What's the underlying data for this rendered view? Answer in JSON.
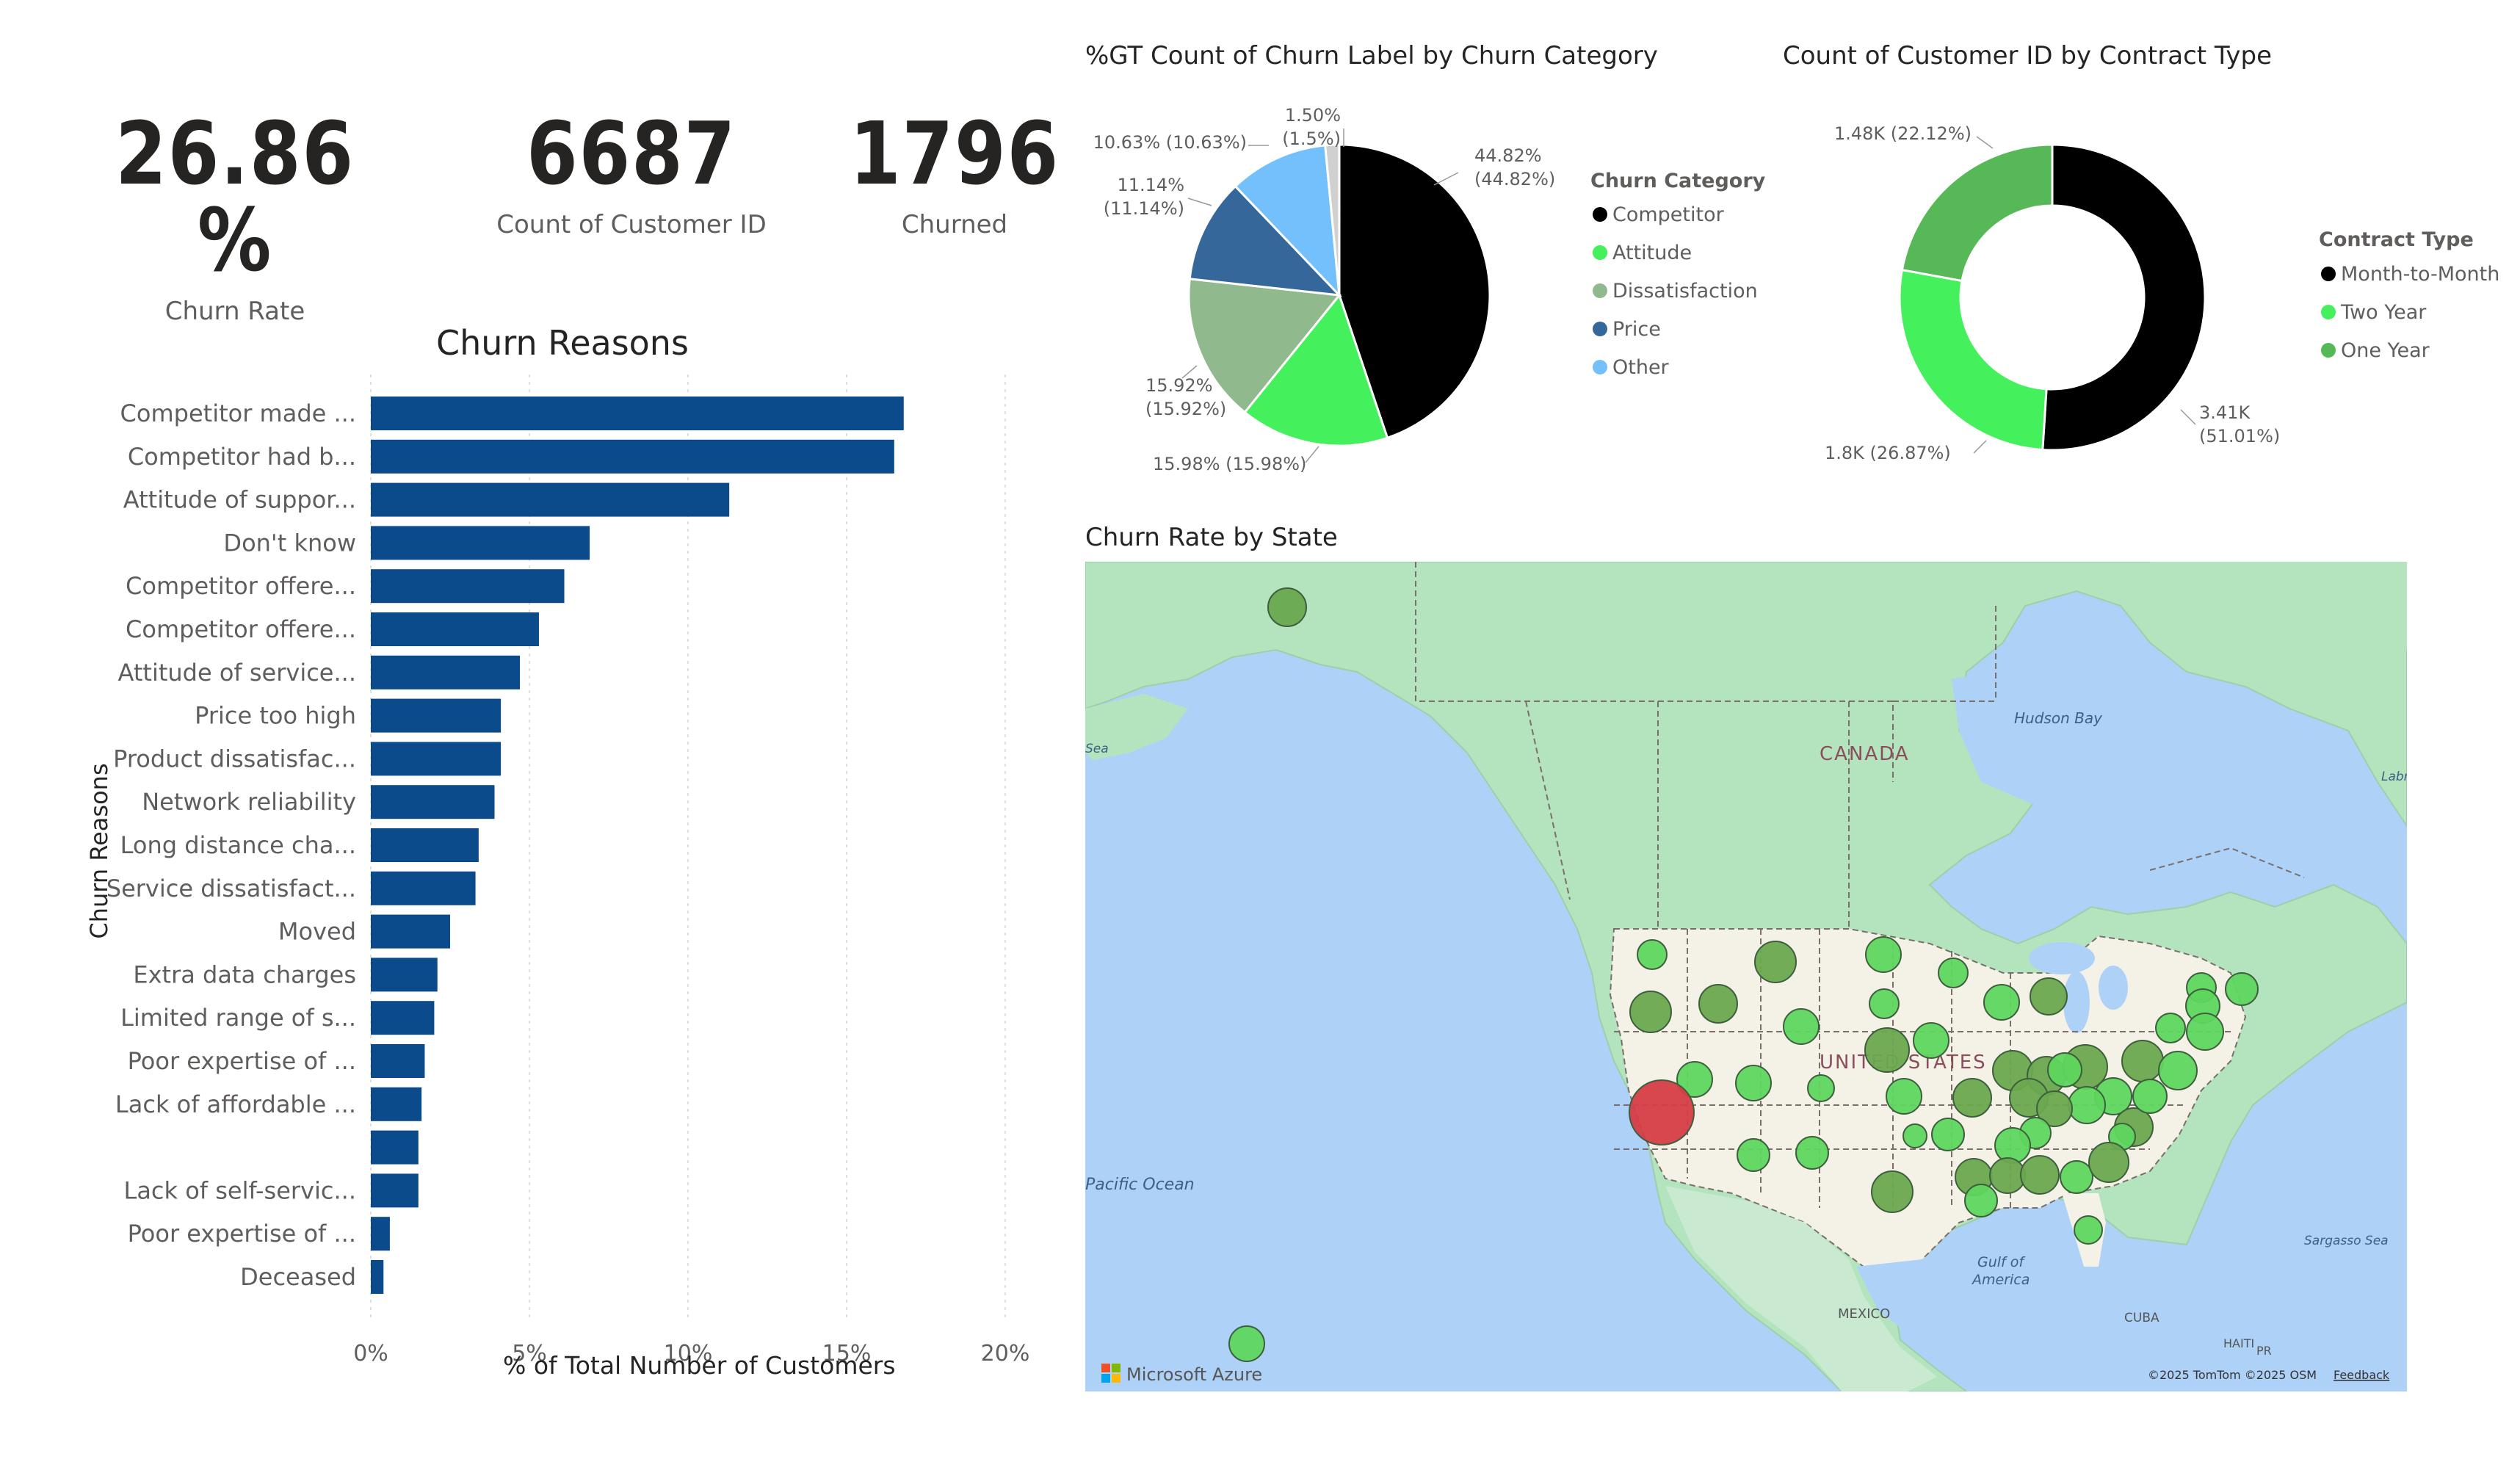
{
  "kpis": [
    {
      "value": "26.86 %",
      "label": "Churn Rate"
    },
    {
      "value": "6687",
      "label": "Count of Customer ID"
    },
    {
      "value": "1796",
      "label": "Churned"
    }
  ],
  "churn_reasons": {
    "title": "Churn Reasons",
    "ylabel": "Churn Reasons",
    "xlabel": "% of Total Number of Customers",
    "ticks": [
      "0%",
      "5%",
      "10%",
      "15%",
      "20%"
    ]
  },
  "pie": {
    "title": "%GT Count of Churn Label by Churn Category",
    "legend_title": "Churn Category",
    "labels": [
      "44.82%\n(44.82%)",
      "15.98% (15.98%)",
      "15.92%\n(15.92%)",
      "11.14%\n(11.14%)",
      "10.63% (10.63%)",
      "1.50%\n(1.5%)"
    ]
  },
  "donut": {
    "title": "Count of Customer ID by Contract Type",
    "legend_title": "Contract Type",
    "labels": [
      "3.41K\n(51.01%)",
      "1.8K (26.87%)",
      "1.48K (22.12%)"
    ]
  },
  "map": {
    "title": "Churn Rate by State",
    "labels": {
      "canada": "CANADA",
      "us": "UNITED STATES",
      "mexico": "MEXICO",
      "hudson": "Hudson Bay",
      "pacific": "Pacific Ocean",
      "gulf1": "Gulf of",
      "gulf2": "America",
      "sargasso": "Sargasso Sea",
      "labra": "Labra",
      "sea": "Sea",
      "cuba": "CUBA",
      "haiti": "HAITI",
      "pr": "PR"
    },
    "brand": "Microsoft Azure",
    "attribution": "©2025 TomTom  ©2025 OSM",
    "feedback": "Feedback"
  },
  "chart_data": [
    {
      "type": "bar",
      "title": "Churn Reasons",
      "xlabel": "% of Total Number of Customers",
      "ylabel": "Churn Reasons",
      "xlim": [
        0,
        20
      ],
      "grid": true,
      "color": "#0b4a8b",
      "categories": [
        "Competitor made ...",
        "Competitor had b...",
        "Attitude of suppor...",
        "Don't know",
        "Competitor offere...",
        "Competitor offere...",
        "Attitude of service...",
        "Price too high",
        "Product dissatisfac...",
        "Network reliability",
        "Long distance cha...",
        "Service dissatisfact...",
        "Moved",
        "Extra data charges",
        "Limited range of s...",
        "Poor expertise of ...",
        "Lack of affordable ...",
        "",
        "Lack of self-servic...",
        "Poor expertise of ...",
        "Deceased"
      ],
      "values": [
        16.8,
        16.5,
        11.3,
        6.9,
        6.1,
        5.3,
        4.7,
        4.1,
        4.1,
        3.9,
        3.4,
        3.3,
        2.5,
        2.1,
        2.0,
        1.7,
        1.6,
        1.5,
        1.5,
        0.6,
        0.4
      ]
    },
    {
      "type": "pie",
      "title": "%GT Count of Churn Label by Churn Category",
      "legend_title": "Churn Category",
      "legend_position": "right",
      "categories": [
        "Competitor",
        "Attitude",
        "Dissatisfaction",
        "Price",
        "Other"
      ],
      "values": [
        44.82,
        15.98,
        15.92,
        11.14,
        10.63
      ],
      "extra_slice": {
        "value": 1.5,
        "color": "#d0d0d0"
      },
      "colors": [
        "#000000",
        "#44f15c",
        "#90b98d",
        "#36679a",
        "#74c0fc"
      ]
    },
    {
      "type": "pie",
      "subtype": "donut",
      "title": "Count of Customer ID by Contract Type",
      "legend_title": "Contract Type",
      "legend_position": "right",
      "categories": [
        "Month-to-Month",
        "Two Year",
        "One Year"
      ],
      "values": [
        51.01,
        26.87,
        22.12
      ],
      "counts": [
        "3.41K",
        "1.8K",
        "1.48K"
      ],
      "colors": [
        "#000000",
        "#44f15c",
        "#57b857"
      ]
    }
  ],
  "colors": {
    "bar": "#0b4a8b",
    "map_water": "#aed2f7",
    "map_land": "#b3e4be",
    "map_us_land": "#f4f1e7",
    "bubble_low": "#5ed65e",
    "bubble_mid": "#6aa84f",
    "bubble_high": "#d63c46"
  }
}
